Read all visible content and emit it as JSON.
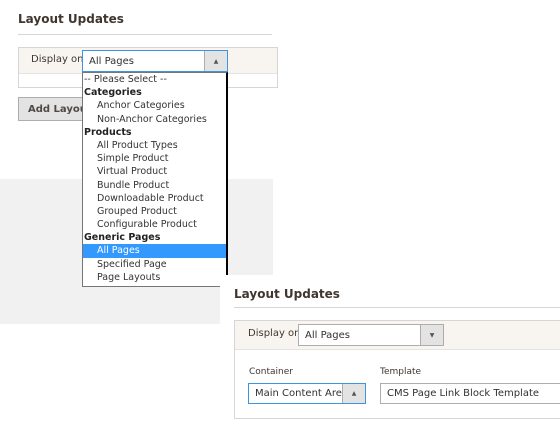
{
  "left_panel": {
    "title": "Layout Updates",
    "display_on_label": "Display on",
    "display_on_value": "All Pages",
    "add_button": "Add Layout Update",
    "dropdown_options": [
      {
        "label": "-- Please Select --",
        "type": "placeholder"
      },
      {
        "label": "Categories",
        "type": "group"
      },
      {
        "label": "Anchor Categories",
        "type": "option"
      },
      {
        "label": "Non-Anchor Categories",
        "type": "option"
      },
      {
        "label": "Products",
        "type": "group"
      },
      {
        "label": "All Product Types",
        "type": "option"
      },
      {
        "label": "Simple Product",
        "type": "option"
      },
      {
        "label": "Virtual Product",
        "type": "option"
      },
      {
        "label": "Bundle Product",
        "type": "option"
      },
      {
        "label": "Downloadable Product",
        "type": "option"
      },
      {
        "label": "Grouped Product",
        "type": "option"
      },
      {
        "label": "Configurable Product",
        "type": "option"
      },
      {
        "label": "Generic Pages",
        "type": "group"
      },
      {
        "label": "All Pages",
        "type": "option",
        "selected": true
      },
      {
        "label": "Specified Page",
        "type": "option"
      },
      {
        "label": "Page Layouts",
        "type": "option"
      }
    ]
  },
  "right_panel": {
    "title": "Layout Updates",
    "display_on_label": "Display on",
    "display_on_value": "All Pages",
    "container_label": "Container",
    "container_value": "Main Content Area",
    "template_label": "Template",
    "template_value": "CMS Page Link Block Template"
  }
}
